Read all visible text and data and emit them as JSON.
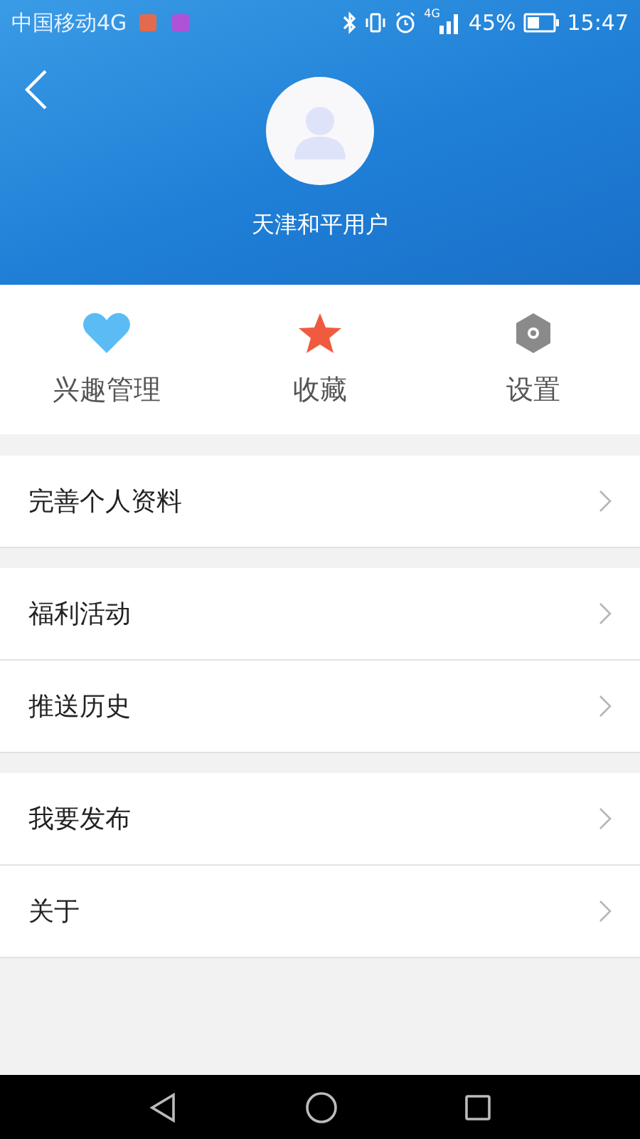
{
  "status_bar": {
    "carrier": "中国移动4G",
    "network_label": "4G",
    "battery": "45%",
    "time": "15:47"
  },
  "profile": {
    "username": "天津和平用户"
  },
  "shortcuts": [
    {
      "kind": "heart",
      "label": "兴趣管理"
    },
    {
      "kind": "star",
      "label": "收藏"
    },
    {
      "kind": "gear",
      "label": "设置"
    }
  ],
  "menu_groups": [
    {
      "items": [
        {
          "label": "完善个人资料"
        }
      ]
    },
    {
      "items": [
        {
          "label": "福利活动"
        },
        {
          "label": "推送历史"
        }
      ]
    },
    {
      "items": [
        {
          "label": "我要发布"
        },
        {
          "label": "关于"
        }
      ]
    }
  ]
}
